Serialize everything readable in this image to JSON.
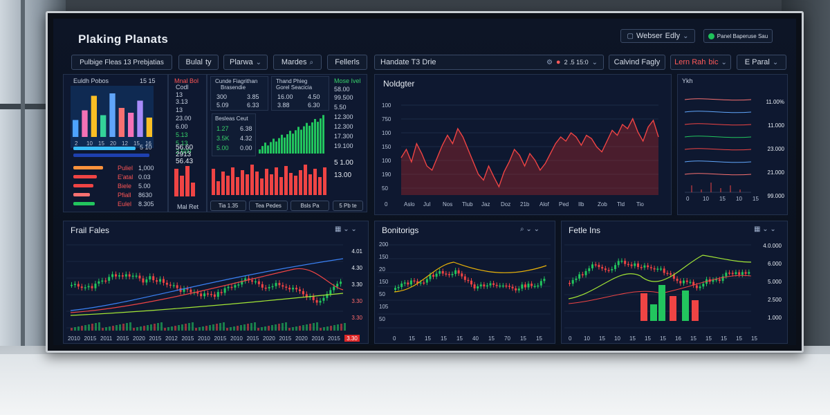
{
  "app": {
    "title": "Plaking Planats"
  },
  "topbar": {
    "search_label": "Webser",
    "search_suffix": "Edly",
    "status_label": "Panel Baperuse Sau"
  },
  "toolbar": {
    "group_label": "Pulbige Fleas 13 Prebjatias",
    "dropdown1": "Bulal",
    "dropdown1_suffix": "ty",
    "dropdown2": "Plarwa",
    "search_label": "Mardes",
    "filters_label": "Fellerls",
    "main_chart_title": "Handate T3 Drie",
    "main_chart_value": "2 .5 15:0",
    "button1": "Calvind Fagly",
    "button2": "Lern Rah",
    "button2_suffix": "bic",
    "button3": "E Paral"
  },
  "colors": {
    "up": "#22c55e",
    "down": "#ef4444",
    "accent": "#3b82f6",
    "bg": "#0e1830"
  },
  "panel_a": {
    "header": "Euldh Pobos",
    "header_value": "15 15",
    "bars": [
      {
        "v": 0.35,
        "c": "#4da3ff"
      },
      {
        "v": 0.55,
        "c": "#f472b6"
      },
      {
        "v": 0.85,
        "c": "#fbbf24"
      },
      {
        "v": 0.45,
        "c": "#34d399"
      },
      {
        "v": 0.9,
        "c": "#60a5fa"
      },
      {
        "v": 0.6,
        "c": "#f87171"
      },
      {
        "v": 0.5,
        "c": "#f472b6"
      },
      {
        "v": 0.75,
        "c": "#a78bfa"
      },
      {
        "v": 0.4,
        "c": "#fbbf24"
      }
    ],
    "xticks": [
      "2",
      "10",
      "15",
      "20",
      "12",
      "15",
      "16"
    ],
    "legend_value": "5 10",
    "rows": [
      {
        "label": "Puliel",
        "value": "1,000",
        "c": "#fb923c",
        "w": 0.9
      },
      {
        "label": "E'atal",
        "value": "0.03",
        "c": "#ef4444",
        "w": 0.7
      },
      {
        "label": "Biele",
        "value": "5.00",
        "c": "#ef4444",
        "w": 0.6
      },
      {
        "label": "Pfiall",
        "value": "8630",
        "c": "#f87171",
        "w": 0.5
      },
      {
        "label": "Eulel",
        "value": "8.305",
        "c": "#22c55e",
        "w": 0.65
      }
    ]
  },
  "panel_b": {
    "header": "Mnal Bol",
    "header2": "Codl",
    "values": [
      "13",
      "3.13",
      "13",
      "23.00",
      "6.00",
      "5.13",
      "5.13",
      "2.500",
      "56.60",
      "2913",
      "56.43"
    ],
    "footer": "Mal Ret"
  },
  "panel_c": {
    "header1": "Cunde Fiagrithan",
    "header2": "Brasendie",
    "l1": "300",
    "l2": "5.09",
    "l3": "6.0",
    "r1": "3.85",
    "r2": "6.33",
    "r3": "4.50",
    "mid_header1": "Thand Phieg",
    "mid_header2": "Gorel Seacicia",
    "m1": "16.00",
    "m2": "3.88",
    "m3": "6.30",
    "inner_title": "Besleas Ceut",
    "inner_vals": [
      "1.27",
      "3.5K",
      "5.00"
    ],
    "inner_vals2": [
      "6.38",
      "4.32",
      "0.00"
    ],
    "footer": [
      "Tia 1.35",
      "Tea Pedes",
      "Bsls Pa"
    ]
  },
  "panel_d": {
    "header": "Mose Ivel",
    "values": [
      "58.00",
      "99.500",
      "5.50",
      "12.300",
      "12.300",
      "17.300",
      "19.100",
      "5 1.00",
      "13.00"
    ],
    "footer": "5 Pb te"
  },
  "chart_main": {
    "title": "Noldgter",
    "yticks": [
      "100",
      "750",
      "100",
      "150",
      "100",
      "190",
      "50"
    ],
    "xticks": [
      "0",
      "Aslo",
      "Jul",
      "Nos",
      "Tlub",
      "Jaz",
      "Doz",
      "21b",
      "Alof",
      "Ped",
      "Ilb",
      "Zob",
      "Tld",
      "Tio"
    ]
  },
  "chart_lines": {
    "header": "Ykh",
    "yvalues": [
      "11.00%",
      "11.000",
      "23.000",
      "21.000",
      "99.000"
    ],
    "xticks": [
      "0",
      "10",
      "15",
      "10",
      "15"
    ]
  },
  "chart_c1": {
    "title": "Frail Fales",
    "xticks": [
      "2010",
      "2015",
      "2011",
      "2015",
      "2020",
      "2015",
      "2012",
      "2015",
      "2010",
      "2015",
      "2010",
      "2015",
      "2020",
      "2015",
      "2020",
      "2016",
      "2015",
      "2020"
    ],
    "yvalues": [
      "4.01",
      "4.30",
      "3.30",
      "3.30",
      "3.30"
    ],
    "badge": "3.30"
  },
  "chart_c2": {
    "title": "Bonitorigs",
    "yticks": [
      "200",
      "150",
      "20",
      "150",
      "50",
      "105",
      "50"
    ],
    "xticks": [
      "0",
      "15",
      "15",
      "15",
      "15",
      "40",
      "15",
      "70",
      "15",
      "15"
    ]
  },
  "chart_c3": {
    "title": "Fetle Ins",
    "yvalues": [
      "4.0.000",
      "6.000",
      "5.000",
      "2.500",
      "1.000"
    ],
    "xticks": [
      "0",
      "10",
      "15",
      "10",
      "15",
      "15",
      "15",
      "16",
      "15",
      "15",
      "15",
      "15",
      "15"
    ]
  }
}
